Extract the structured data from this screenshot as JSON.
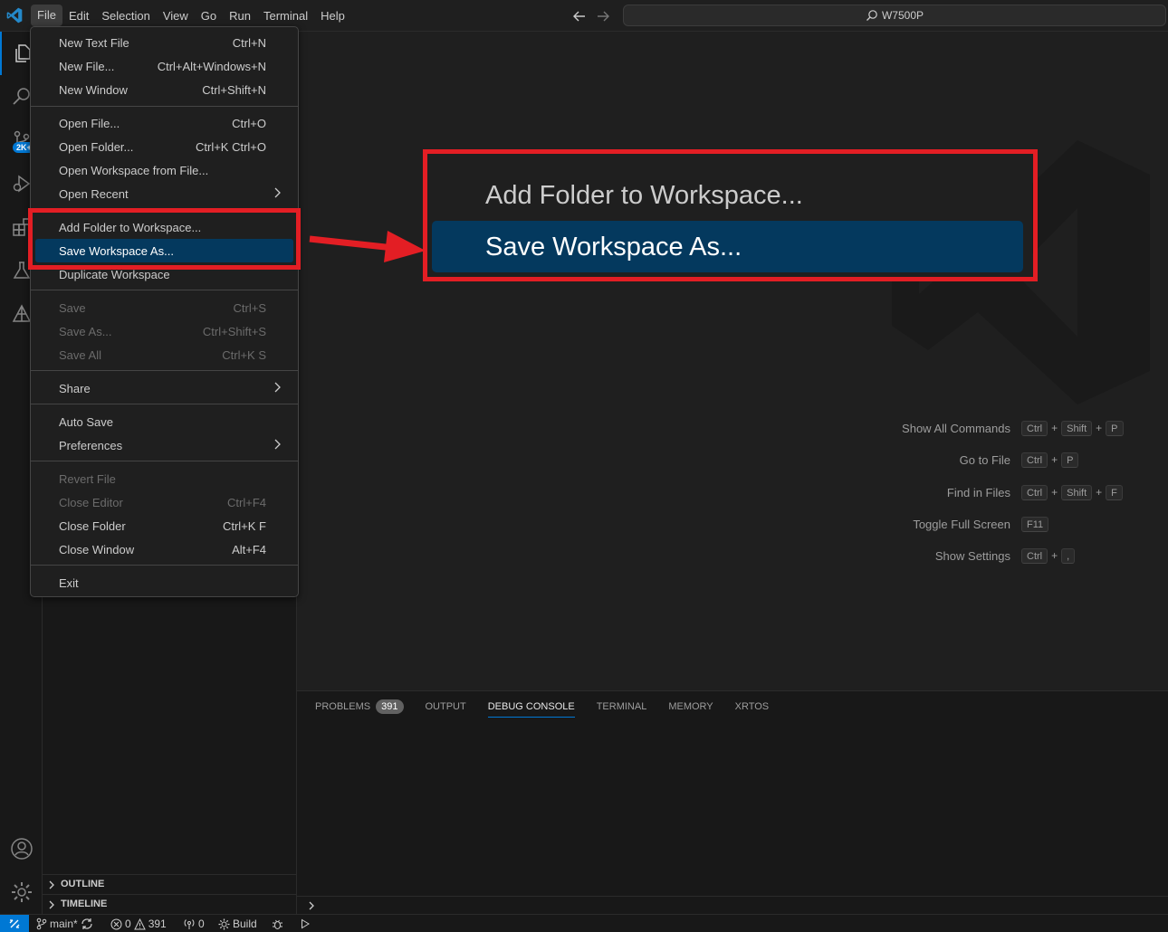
{
  "titlebar": {
    "menus": [
      "File",
      "Edit",
      "Selection",
      "View",
      "Go",
      "Run",
      "Terminal",
      "Help"
    ],
    "search_text": "W7500P"
  },
  "activity": {
    "scm_badge": "2K+"
  },
  "file_menu": {
    "items": [
      {
        "label": "New Text File",
        "shortcut": "Ctrl+N"
      },
      {
        "label": "New File...",
        "shortcut": "Ctrl+Alt+Windows+N"
      },
      {
        "label": "New Window",
        "shortcut": "Ctrl+Shift+N"
      },
      {
        "label": "Open File...",
        "shortcut": "Ctrl+O"
      },
      {
        "label": "Open Folder...",
        "shortcut": "Ctrl+K Ctrl+O"
      },
      {
        "label": "Open Workspace from File...",
        "shortcut": ""
      },
      {
        "label": "Open Recent",
        "shortcut": ""
      },
      {
        "label": "Add Folder to Workspace...",
        "shortcut": ""
      },
      {
        "label": "Save Workspace As...",
        "shortcut": ""
      },
      {
        "label": "Duplicate Workspace",
        "shortcut": ""
      },
      {
        "label": "Save",
        "shortcut": "Ctrl+S"
      },
      {
        "label": "Save As...",
        "shortcut": "Ctrl+Shift+S"
      },
      {
        "label": "Save All",
        "shortcut": "Ctrl+K S"
      },
      {
        "label": "Share",
        "shortcut": ""
      },
      {
        "label": "Auto Save",
        "shortcut": ""
      },
      {
        "label": "Preferences",
        "shortcut": ""
      },
      {
        "label": "Revert File",
        "shortcut": ""
      },
      {
        "label": "Close Editor",
        "shortcut": "Ctrl+F4"
      },
      {
        "label": "Close Folder",
        "shortcut": "Ctrl+K F"
      },
      {
        "label": "Close Window",
        "shortcut": "Alt+F4"
      },
      {
        "label": "Exit",
        "shortcut": ""
      }
    ]
  },
  "zoom_callout": {
    "add_label": "Add Folder to Workspace...",
    "save_label": "Save Workspace As..."
  },
  "watermark": {
    "shortcuts": [
      {
        "label": "Show All Commands",
        "keys": [
          "Ctrl",
          "Shift",
          "P"
        ]
      },
      {
        "label": "Go to File",
        "keys": [
          "Ctrl",
          "P"
        ]
      },
      {
        "label": "Find in Files",
        "keys": [
          "Ctrl",
          "Shift",
          "F"
        ]
      },
      {
        "label": "Toggle Full Screen",
        "keys": [
          "F11"
        ]
      },
      {
        "label": "Show Settings",
        "keys": [
          "Ctrl",
          ","
        ]
      }
    ]
  },
  "sidebar": {
    "outline": "OUTLINE",
    "timeline": "TIMELINE"
  },
  "panel": {
    "tabs": [
      "PROBLEMS",
      "OUTPUT",
      "DEBUG CONSOLE",
      "TERMINAL",
      "MEMORY",
      "XRTOS"
    ],
    "problems_count": "391",
    "active_tab": "DEBUG CONSOLE"
  },
  "statusbar": {
    "branch": "main*",
    "errors": "0",
    "warnings": "391",
    "ports": "0",
    "build": "Build"
  },
  "colors": {
    "accent": "#0078d4",
    "highlight": "#04395e",
    "annotation": "#e31e24"
  }
}
